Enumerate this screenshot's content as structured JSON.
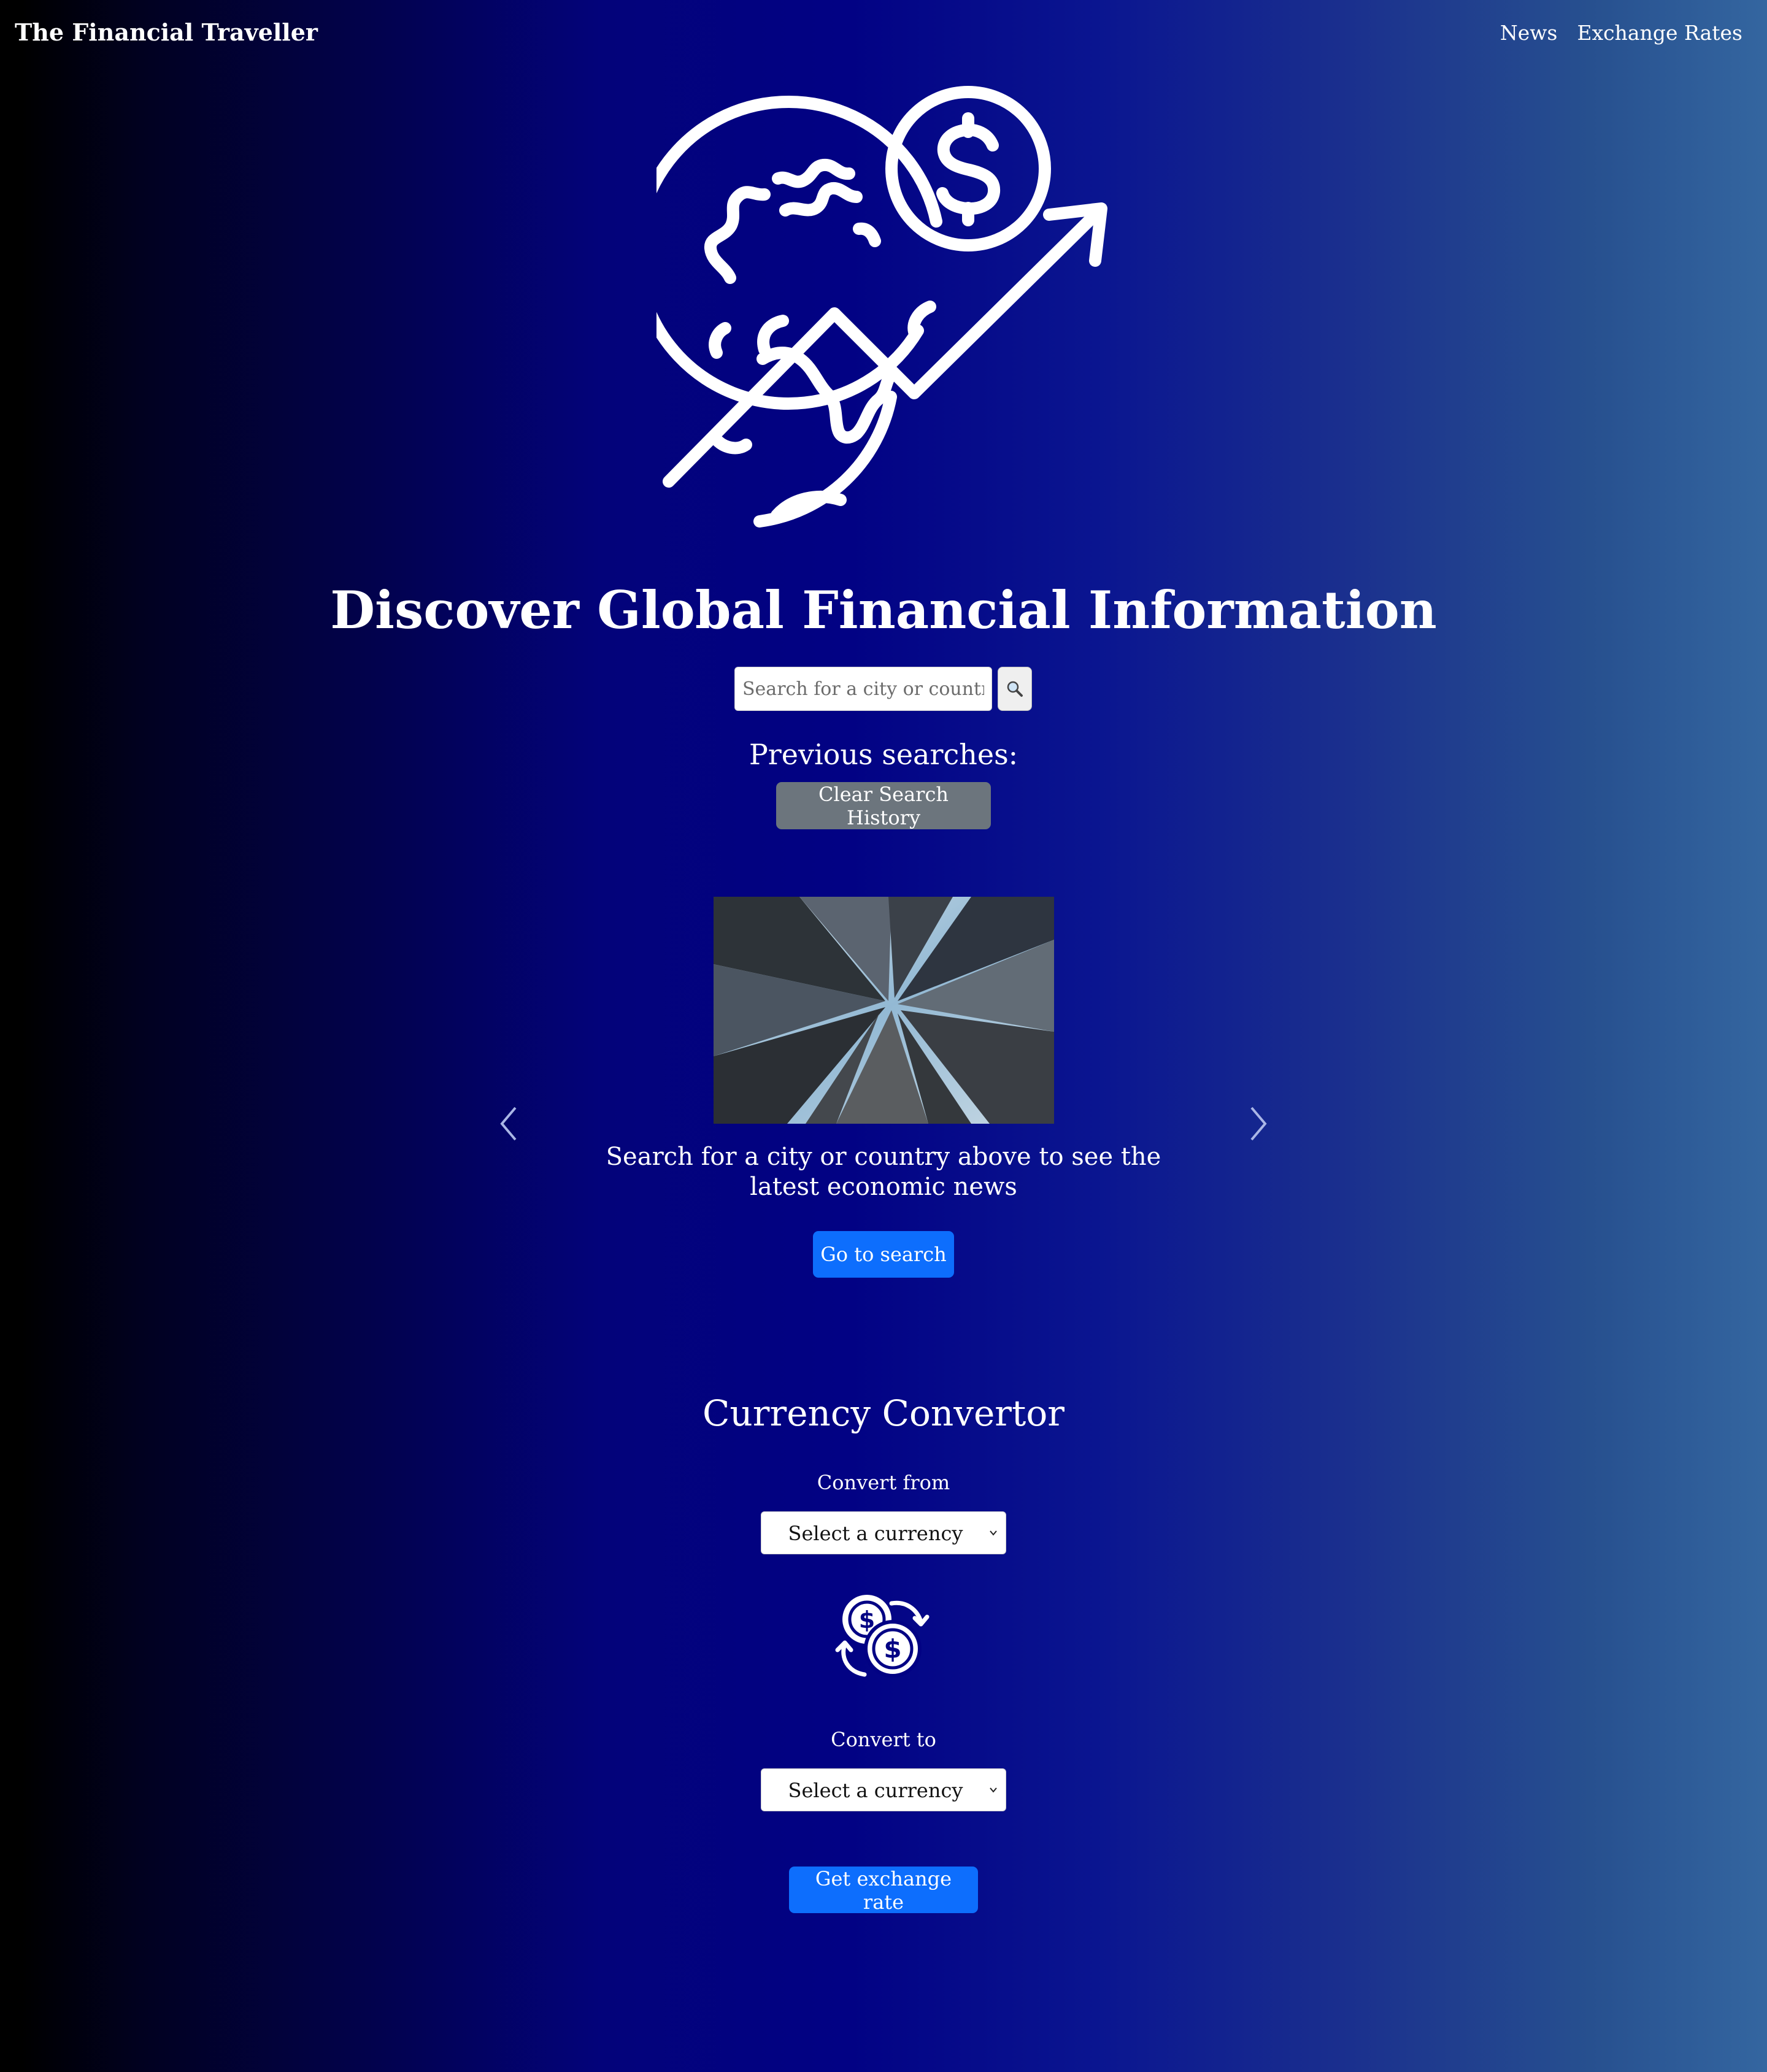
{
  "nav": {
    "brand": "The Financial Traveller",
    "links": [
      {
        "label": "News"
      },
      {
        "label": "Exchange Rates"
      }
    ]
  },
  "hero": {
    "logo_icon": "globe-dollar-growth-icon",
    "title": "Discover Global Financial Information"
  },
  "search": {
    "placeholder": "Search for a city or country",
    "value": "",
    "button_icon": "magnifier-icon"
  },
  "history": {
    "label": "Previous searches:",
    "clear_button": "Clear Search History"
  },
  "carousel": {
    "image_description_icon": "skyscrapers-photo",
    "caption": "Search for a city or country above to see the latest economic news",
    "button": "Go to search",
    "prev_icon": "chevron-left-icon",
    "next_icon": "chevron-right-icon"
  },
  "converter": {
    "title": "Currency Convertor",
    "from_label": "Convert from",
    "from_value": "Select a currency",
    "swap_icon": "currency-exchange-icon",
    "to_label": "Convert to",
    "to_value": "Select a currency",
    "button": "Get exchange rate"
  },
  "colors": {
    "primary_button": "#0d6efd",
    "secondary_button": "#6c757d",
    "background_mid": "#020284",
    "background_right": "#3466a0"
  }
}
